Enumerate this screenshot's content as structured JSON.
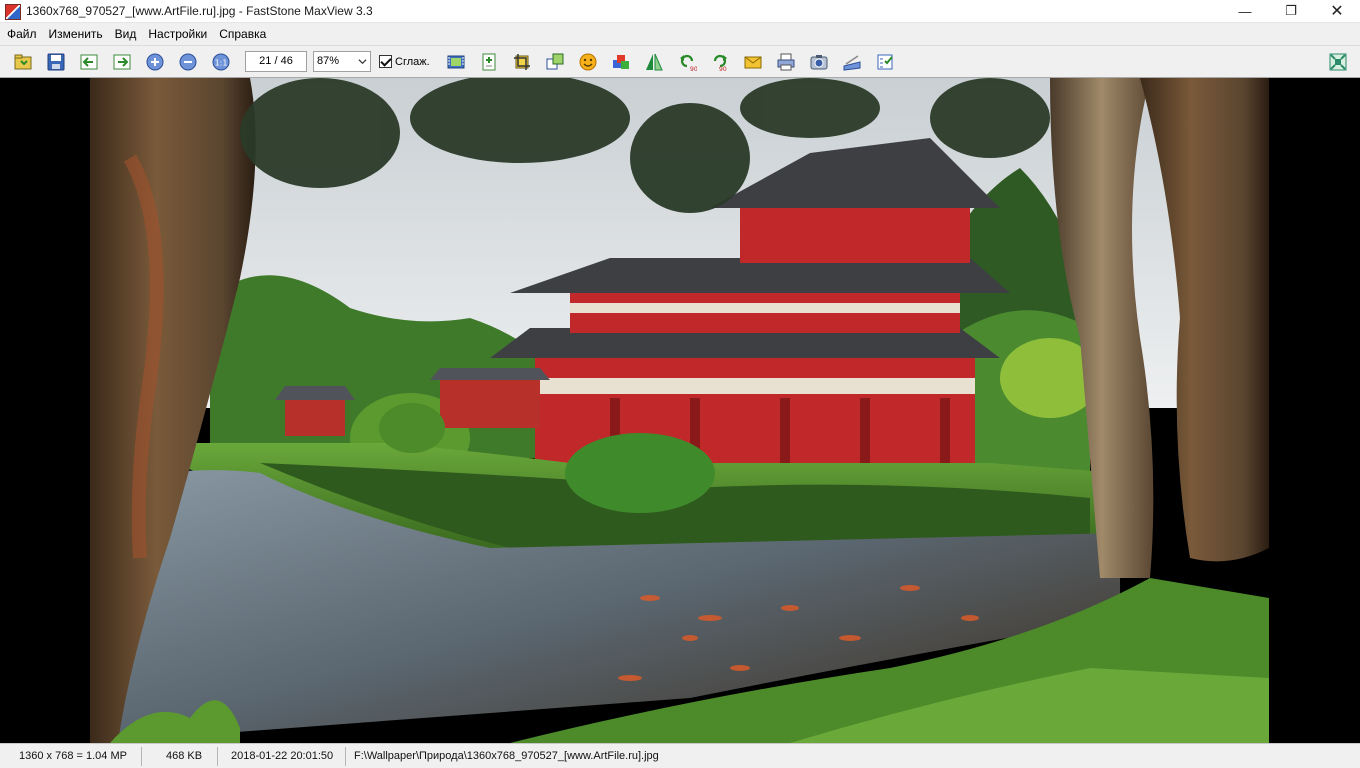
{
  "window": {
    "title": "1360x768_970527_[www.ArtFile.ru].jpg - FastStone MaxView 3.3",
    "minimize": "—",
    "maximize": "❐",
    "close": "✕"
  },
  "menu": {
    "items": [
      {
        "label": "Файл"
      },
      {
        "label": "Изменить"
      },
      {
        "label": "Вид"
      },
      {
        "label": "Настройки"
      },
      {
        "label": "Справка"
      }
    ]
  },
  "toolbar": {
    "buttons_left": [
      "open-icon",
      "save-icon",
      "previous-icon",
      "next-icon",
      "zoom-in-icon",
      "zoom-out-icon",
      "actual-size-icon"
    ],
    "page_counter": "21 / 46",
    "zoom_value": "87%",
    "smooth_label": "Сглаж.",
    "smooth_checked": true,
    "buttons_right": [
      "slideshow-icon",
      "copy-to-icon",
      "crop-icon",
      "resize-icon",
      "emoticon-icon",
      "color-adjust-icon",
      "flip-icon",
      "rotate-left-icon",
      "rotate-right-icon",
      "email-icon",
      "print-icon",
      "screenshot-icon",
      "scanner-icon",
      "settings-checklist-icon"
    ],
    "fullscreen_icon": "fullscreen-icon"
  },
  "viewer": {
    "image_subject": "red Japanese temple beside koi pond"
  },
  "status": {
    "dimensions": "1360 x 768 = 1.04 MP",
    "filesize": "468 KB",
    "datetime": "2018-01-22 20:01:50",
    "path": "F:\\Wallpaper\\Природа\\1360x768_970527_[www.ArtFile.ru].jpg"
  },
  "colors": {
    "chrome": "#f0f0f0",
    "temple_red": "#c0282a",
    "pond": "#4a5560",
    "foliage": "#3f7a2a"
  }
}
